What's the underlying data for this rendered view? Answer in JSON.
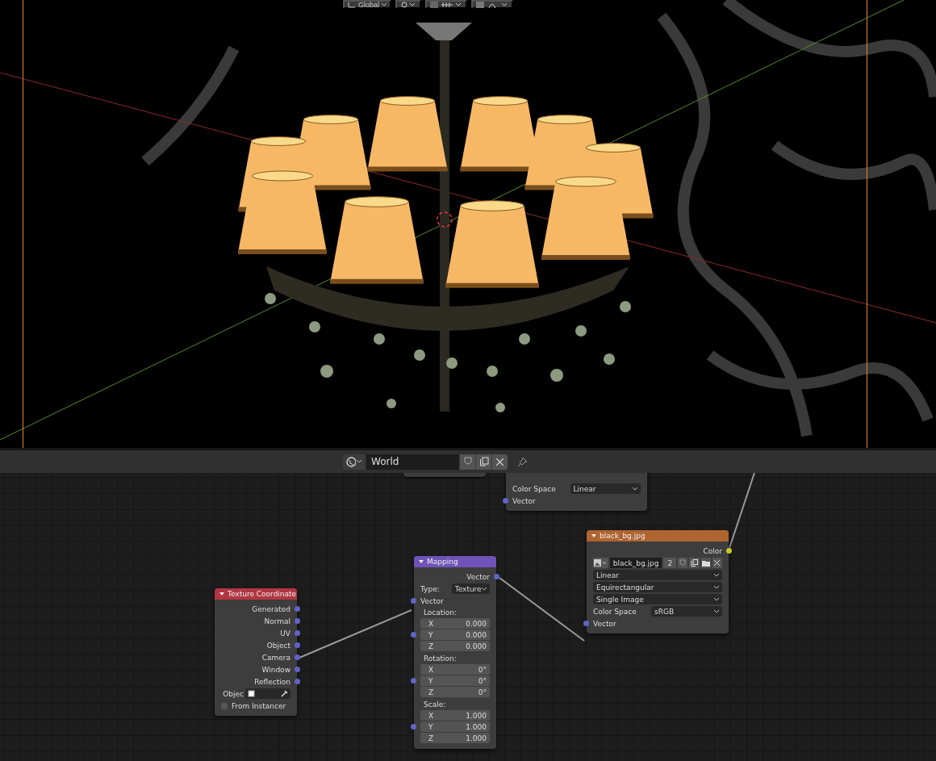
{
  "viewport": {
    "orientation": "Global"
  },
  "header": {
    "world_name": "World"
  },
  "nodes": [
    {
      "rows": [
        {
          "kind": "prop",
          "label": "Color Space",
          "value": "Linear"
        },
        {
          "kind": "input",
          "label": "Vector",
          "color": "#6363c7"
        }
      ]
    },
    {
      "title": "Texture Coordinate",
      "color": "#b13642",
      "rows": [
        {
          "kind": "output",
          "label": "Generated",
          "color": "#6363c7"
        },
        {
          "kind": "output",
          "label": "Normal",
          "color": "#6363c7"
        },
        {
          "kind": "output",
          "label": "UV",
          "color": "#6363c7"
        },
        {
          "kind": "output",
          "label": "Object",
          "color": "#6363c7"
        },
        {
          "kind": "output",
          "label": "Camera",
          "color": "#6363c7"
        },
        {
          "kind": "output",
          "label": "Window",
          "color": "#6363c7"
        },
        {
          "kind": "output",
          "label": "Reflection",
          "color": "#6363c7"
        },
        {
          "kind": "object",
          "label": "Objec"
        },
        {
          "kind": "checkbox",
          "label": "From Instancer",
          "checked": false
        }
      ]
    },
    {
      "title": "Mapping",
      "color": "#6f53b8",
      "rows": [
        {
          "kind": "output",
          "label": "Vector",
          "color": "#6363c7"
        },
        {
          "kind": "prop",
          "label": "Type:",
          "value": "Texture"
        },
        {
          "kind": "input",
          "label": "Vector",
          "color": "#6363c7"
        },
        {
          "kind": "group",
          "label": "Location:",
          "color": "#6363c7",
          "fields": [
            {
              "axis": "X",
              "value": "0.000"
            },
            {
              "axis": "Y",
              "value": "0.000"
            },
            {
              "axis": "Z",
              "value": "0.000"
            }
          ]
        },
        {
          "kind": "group",
          "label": "Rotation:",
          "color": "#6363c7",
          "fields": [
            {
              "axis": "X",
              "value": "0°"
            },
            {
              "axis": "Y",
              "value": "0°"
            },
            {
              "axis": "Z",
              "value": "0°"
            }
          ]
        },
        {
          "kind": "group",
          "label": "Scale:",
          "color": "#6363c7",
          "fields": [
            {
              "axis": "X",
              "value": "1.000"
            },
            {
              "axis": "Y",
              "value": "1.000"
            },
            {
              "axis": "Z",
              "value": "1.000"
            }
          ]
        }
      ]
    },
    {
      "title": "black_bg.jpg",
      "color": "#b0642f",
      "rows": [
        {
          "kind": "output",
          "label": "Color",
          "color": "#c7c729"
        },
        {
          "kind": "image",
          "name": "black_bg.jpg",
          "users": "2"
        },
        {
          "kind": "select",
          "value": "Linear"
        },
        {
          "kind": "select",
          "value": "Equirectangular"
        },
        {
          "kind": "select",
          "value": "Single Image"
        },
        {
          "kind": "prop",
          "label": "Color Space",
          "value": "sRGB"
        },
        {
          "kind": "input",
          "label": "Vector",
          "color": "#6363c7"
        }
      ]
    }
  ]
}
